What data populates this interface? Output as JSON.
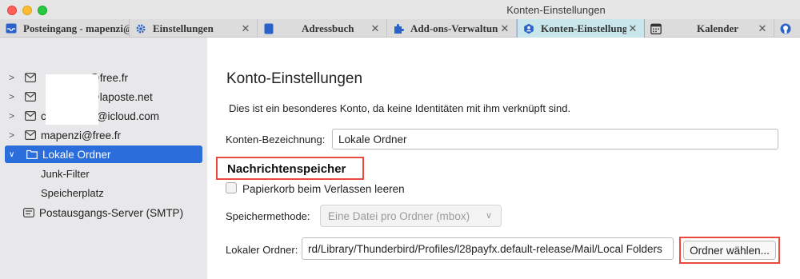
{
  "window": {
    "title": "Konten-Einstellungen"
  },
  "tabs": [
    {
      "label": "Posteingang - mapenzi@free.fr",
      "icon": "inbox-icon"
    },
    {
      "label": "Einstellungen",
      "icon": "gear-icon"
    },
    {
      "label": "Adressbuch",
      "icon": "address-book-icon"
    },
    {
      "label": "Add-ons-Verwaltung",
      "icon": "puzzle-icon"
    },
    {
      "label": "Konten-Einstellungen",
      "icon": "account-settings-icon",
      "active": true
    },
    {
      "label": "Kalender",
      "icon": "calendar-icon"
    },
    {
      "label": "",
      "icon": "github-icon"
    }
  ],
  "sidebar": {
    "accounts": [
      {
        "label": "@free.fr",
        "icon": "mail-account-icon"
      },
      {
        "label": "@laposte.net",
        "icon": "mail-account-icon"
      },
      {
        "label": "@icloud.com",
        "icon": "mail-account-icon",
        "prefix": "c"
      },
      {
        "label": "mapenzi@free.fr",
        "icon": "mail-account-icon"
      },
      {
        "label": "Lokale Ordner",
        "icon": "folder-icon",
        "selected": true
      }
    ],
    "subitems": [
      "Junk-Filter",
      "Speicherplatz"
    ],
    "smtp": {
      "label": "Postausgangs-Server (SMTP)",
      "icon": "outgoing-server-icon"
    }
  },
  "main": {
    "heading": "Konto-Einstellungen",
    "note": "Dies ist ein besonderes Konto, da keine Identitäten mit ihm verknüpft sind.",
    "account_name_label": "Konten-Bezeichnung:",
    "account_name_value": "Lokale Ordner",
    "section_title": "Nachrichtenspeicher",
    "trash_checkbox_label": "Papierkorb beim Verlassen leeren",
    "trash_checked": false,
    "storage_method_label": "Speichermethode:",
    "storage_method_value": "Eine Datei pro Ordner (mbox)",
    "local_folder_label": "Lokaler Ordner:",
    "local_folder_value": "rd/Library/Thunderbird/Profiles/l28payfx.default-release/Mail/Local Folders",
    "choose_folder_button": "Ordner wählen..."
  },
  "colors": {
    "selection": "#2a6ddb",
    "highlight_border": "#e84a3e",
    "active_tab": "#c9e6ea"
  }
}
